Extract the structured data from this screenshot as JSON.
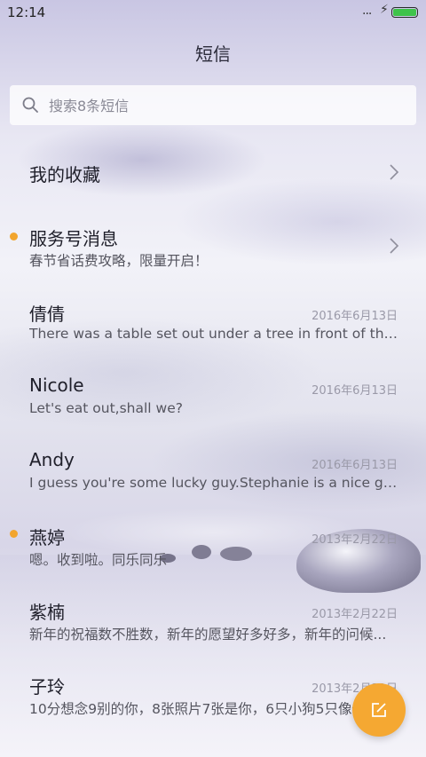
{
  "status": {
    "time": "12:14",
    "dots": "...",
    "bolt": "⚡",
    "battery_level": 1.0,
    "battery_color": "#3ec34a"
  },
  "header": {
    "title": "短信"
  },
  "search": {
    "placeholder": "搜索8条短信"
  },
  "favorites": {
    "label": "我的收藏"
  },
  "service": {
    "name": "服务号消息",
    "preview": "春节省话费攻略，限量开启！",
    "unread": true
  },
  "conversations": [
    {
      "name": "倩倩",
      "preview": "There was a table set out under a tree in front of the ho...",
      "date": "2016年6月13日",
      "unread": false
    },
    {
      "name": "Nicole",
      "preview": "Let's eat out,shall we?",
      "date": "2016年6月13日",
      "unread": false
    },
    {
      "name": "Andy",
      "preview": "I guess you're some lucky guy.Stephanie is a nice girl.",
      "date": "2016年6月13日",
      "unread": false
    },
    {
      "name": "燕婷",
      "preview": "嗯。收到啦。同乐同乐",
      "date": "2013年2月22日",
      "unread": true
    },
    {
      "name": "紫楠",
      "preview": "新年的祝福数不胜数，新年的愿望好多好多，新年的问候...",
      "date": "2013年2月22日",
      "unread": false
    },
    {
      "name": "子玲",
      "preview": "10分想念9别的你，8张照片7张是你，6只小狗5只像你",
      "date": "2013年2月22日",
      "unread": false
    }
  ],
  "colors": {
    "accent": "#f5a832",
    "unread_dot": "#f2a52e"
  },
  "icons": {
    "fab": "compose-icon",
    "search": "search-icon",
    "chevron": "chevron-right-icon"
  }
}
